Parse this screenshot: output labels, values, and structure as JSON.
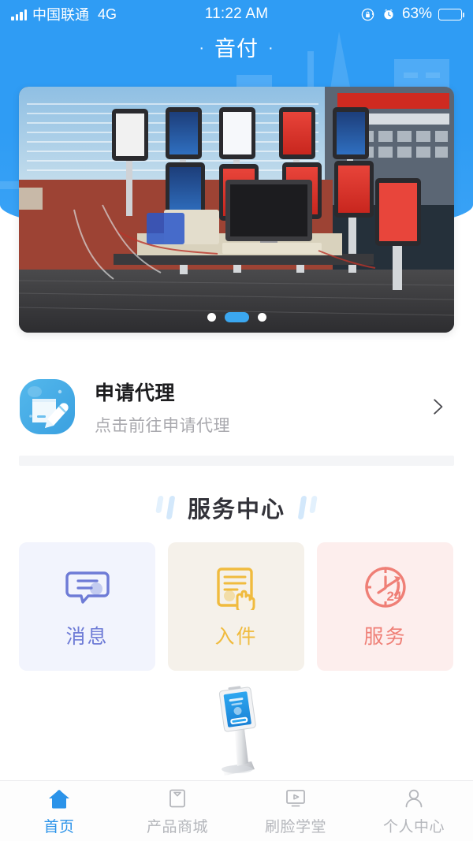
{
  "status_bar": {
    "carrier": "中国联通",
    "network": "4G",
    "time": "11:22 AM",
    "battery_percent": "63%",
    "battery_level": 63,
    "icons": [
      "signal-bars-icon",
      "rotation-lock-icon",
      "alarm-clock-icon",
      "battery-icon"
    ]
  },
  "header": {
    "title": "音付",
    "left_dot": "·",
    "right_dot": "·",
    "accent_color": "#2f9cf4"
  },
  "banner": {
    "name": "promo-carousel",
    "alt": "展台上排列的多台刷脸支付终端设备",
    "dots": [
      {
        "active": false
      },
      {
        "active": true
      },
      {
        "active": false
      }
    ],
    "active_color": "#3ba7f0"
  },
  "agent_entry": {
    "icon": "document-pencil-icon",
    "title": "申请代理",
    "subtitle": "点击前往申请代理",
    "chevron": "chevron-right-icon"
  },
  "service_center": {
    "title": "服务中心",
    "decoration": "double-bar-icon",
    "cards": [
      {
        "label": "消息",
        "icon": "message-bubble-icon",
        "bg": "#f2f4fd",
        "color": "#6e7bd6"
      },
      {
        "label": "入件",
        "icon": "document-hand-icon",
        "bg": "#f5f1ea",
        "color": "#f0bb3e"
      },
      {
        "label": "服务",
        "icon": "clock-24-icon",
        "bg": "#fdeeed",
        "color": "#ef7f76",
        "badge": "24"
      }
    ]
  },
  "product_image": {
    "alt": "立式刷脸支付终端",
    "icon": "kiosk-terminal-icon"
  },
  "tabbar": {
    "active_color": "#2b93e9",
    "inactive_color": "#b4b6bb",
    "items": [
      {
        "label": "首页",
        "icon": "home-icon",
        "active": true
      },
      {
        "label": "产品商城",
        "icon": "shopping-bag-icon",
        "active": false
      },
      {
        "label": "刷脸学堂",
        "icon": "video-monitor-icon",
        "active": false
      },
      {
        "label": "个人中心",
        "icon": "person-icon",
        "active": false
      }
    ]
  }
}
